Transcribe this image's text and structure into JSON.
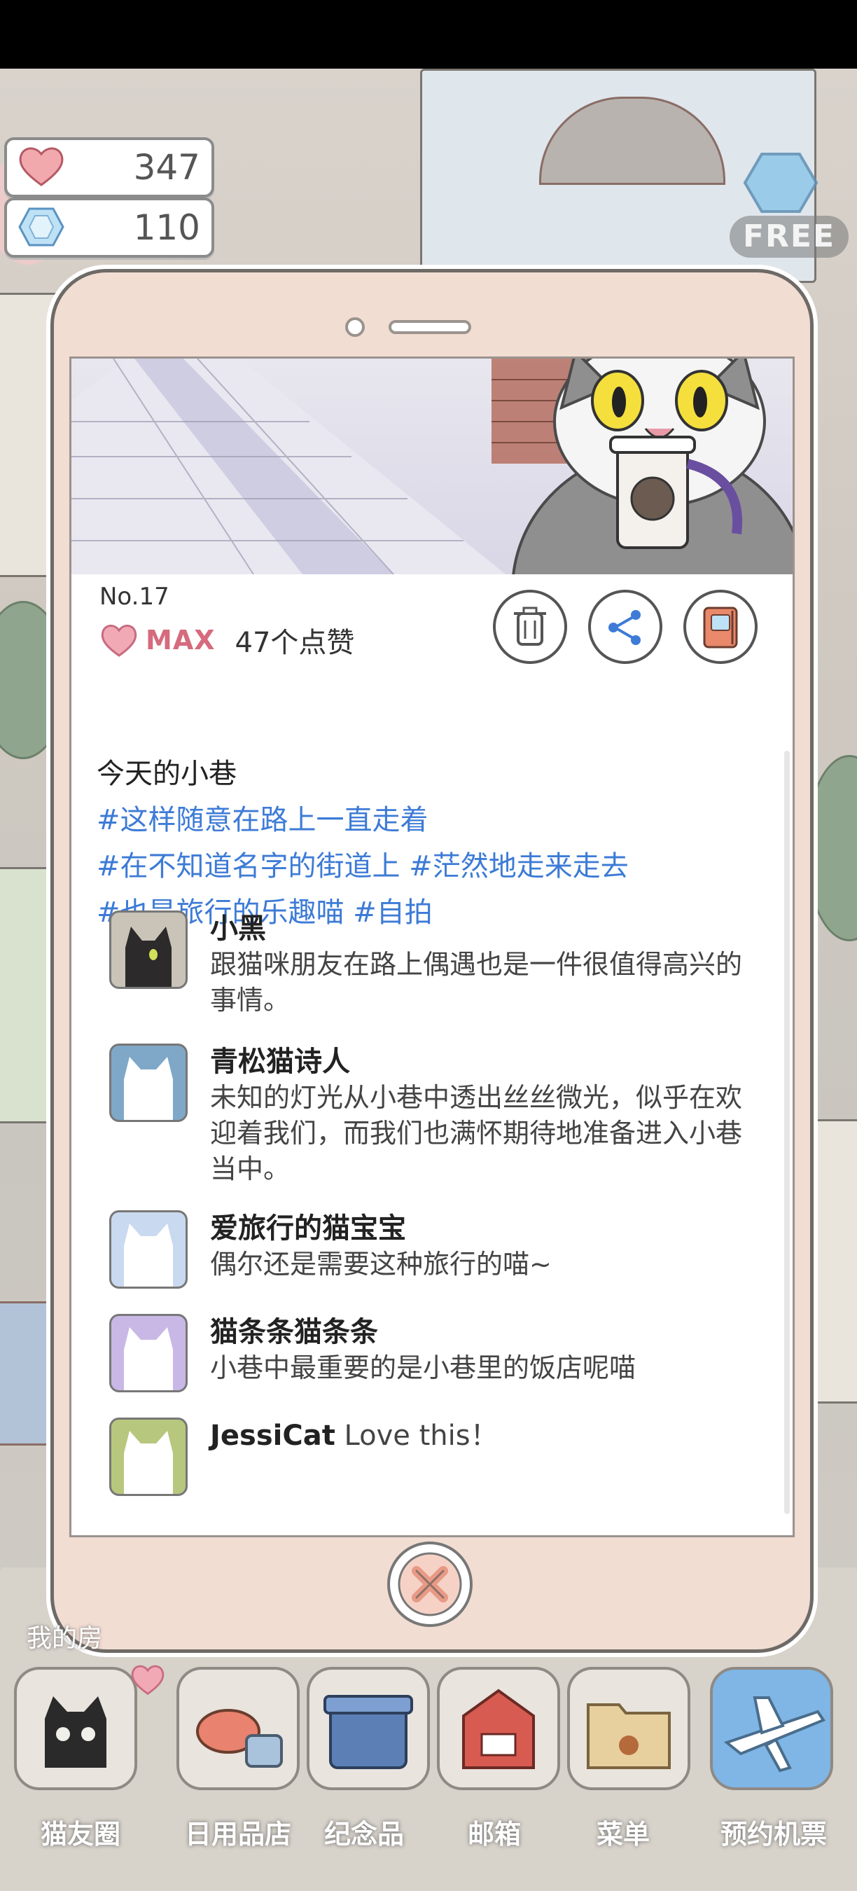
{
  "currency": {
    "hearts": "347",
    "gems": "110"
  },
  "top_right": {
    "free_label": "FREE"
  },
  "post": {
    "number": "No.17",
    "like_level": "MAX",
    "like_count": "47个点赞",
    "title": "今天的小巷",
    "tag_lines": [
      "#这样随意在路上一直走着",
      "#在不知道名字的街道上 #茫然地走来走去",
      "#也是旅行的乐趣喵 #自拍"
    ]
  },
  "comments": [
    {
      "name": "小黑",
      "text": "跟猫咪朋友在路上偶遇也是一件很值得高兴的事情。",
      "avatar_color": "#c9c3b8"
    },
    {
      "name": "青松猫诗人",
      "text": "未知的灯光从小巷中透出丝丝微光，似乎在欢迎着我们，而我们也满怀期待地准备进入小巷当中。",
      "avatar_color": "#7fa8c8"
    },
    {
      "name": "爱旅行的猫宝宝",
      "text": "偶尔还是需要这种旅行的喵~",
      "avatar_color": "#c9daf0"
    },
    {
      "name": "猫条条猫条条",
      "text": "小巷中最重要的是小巷里的饭店呢喵",
      "avatar_color": "#c9b8e6"
    },
    {
      "name": "JessiCat",
      "text": "Love this！",
      "avatar_color": "#b7c77e"
    }
  ],
  "background": {
    "partial_label": "我的房"
  },
  "bottom_nav": [
    {
      "label": "猫友圈"
    },
    {
      "label": "日用品店"
    },
    {
      "label": "纪念品"
    },
    {
      "label": "邮箱"
    },
    {
      "label": "菜单"
    },
    {
      "label": "预约机票"
    }
  ],
  "colors": {
    "accent_pink": "#d56b7d",
    "hashtag_blue": "#3d7bd6",
    "phone_frame": "#f2ddd3"
  }
}
